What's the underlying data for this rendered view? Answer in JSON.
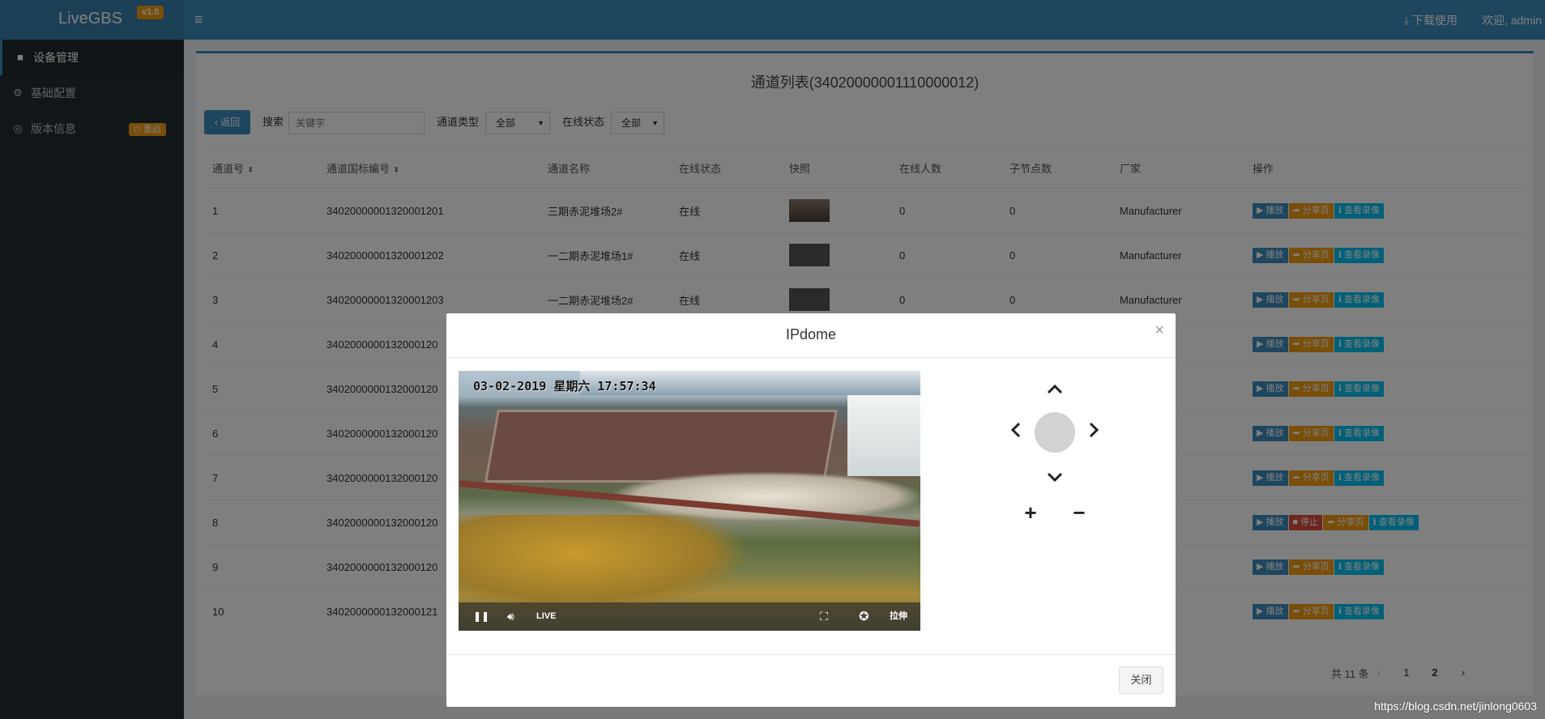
{
  "header": {
    "app_name": "LiveGBS",
    "version": "v1.0",
    "menu_icon": "hamburger-icon",
    "download_label": "下载使用",
    "welcome_label": "欢迎, admin"
  },
  "sidebar": {
    "items": [
      {
        "label": "设备管理",
        "icon": "camera-icon",
        "active": true
      },
      {
        "label": "基础配置",
        "icon": "gears-icon",
        "active": false
      },
      {
        "label": "版本信息",
        "icon": "globe-icon",
        "active": false,
        "badge": "重启"
      }
    ]
  },
  "main": {
    "title": "通道列表(34020000001110000012)",
    "back_label": "返回",
    "search_label": "搜索",
    "search_placeholder": "关键字",
    "channel_type_label": "通道类型",
    "channel_type_value": "全部",
    "online_status_label": "在线状态",
    "online_status_value": "全部",
    "columns": [
      "通道号",
      "通道国标编号",
      "通道名称",
      "在线状态",
      "快照",
      "在线人数",
      "子节点数",
      "厂家",
      "操作"
    ],
    "rows": [
      {
        "no": "1",
        "gbid": "34020000001320001201",
        "name": "三期赤泥堆场2#",
        "status": "在线",
        "online": "0",
        "children": "0",
        "vendor": "Manufacturer"
      },
      {
        "no": "2",
        "gbid": "34020000001320001202",
        "name": "一二期赤泥堆场1#",
        "status": "在线",
        "online": "0",
        "children": "0",
        "vendor": "Manufacturer"
      },
      {
        "no": "3",
        "gbid": "34020000001320001203",
        "name": "一二期赤泥堆场2#",
        "status": "在线",
        "online": "0",
        "children": "0",
        "vendor": "Manufacturer"
      },
      {
        "no": "4",
        "gbid": "3402000000132000120",
        "name": "",
        "status": "",
        "online": "",
        "children": "",
        "vendor": "rer"
      },
      {
        "no": "5",
        "gbid": "3402000000132000120",
        "name": "",
        "status": "",
        "online": "",
        "children": "",
        "vendor": "rer"
      },
      {
        "no": "6",
        "gbid": "3402000000132000120",
        "name": "",
        "status": "",
        "online": "",
        "children": "",
        "vendor": "rer"
      },
      {
        "no": "7",
        "gbid": "3402000000132000120",
        "name": "",
        "status": "",
        "online": "",
        "children": "",
        "vendor": "rer"
      },
      {
        "no": "8",
        "gbid": "3402000000132000120",
        "name": "",
        "status": "",
        "online": "",
        "children": "",
        "vendor": "rer"
      },
      {
        "no": "9",
        "gbid": "3402000000132000120",
        "name": "",
        "status": "",
        "online": "",
        "children": "",
        "vendor": "rer"
      },
      {
        "no": "10",
        "gbid": "3402000000132000121",
        "name": "",
        "status": "",
        "online": "",
        "children": "",
        "vendor": "rer"
      }
    ],
    "ops": {
      "play": "播放",
      "stop": "停止",
      "share": "分享页",
      "record": "查看录像"
    },
    "pager": {
      "total": "共 11 条",
      "prev": "‹",
      "pages": [
        "1",
        "2"
      ],
      "current": "2",
      "next": "›"
    }
  },
  "modal": {
    "title": "IPdome",
    "close_x": "×",
    "close_button": "关闭",
    "video": {
      "osd_text": "03-02-2019 星期六 17:57:34",
      "live_label": "LIVE",
      "stretch_label": "拉伸"
    },
    "ptz": {
      "up": "⌃",
      "down": "⌄",
      "left": "‹",
      "right": "›",
      "zoom_in": "+",
      "zoom_out": "−"
    }
  },
  "watermark": "https://blog.csdn.net/jinlong0603"
}
